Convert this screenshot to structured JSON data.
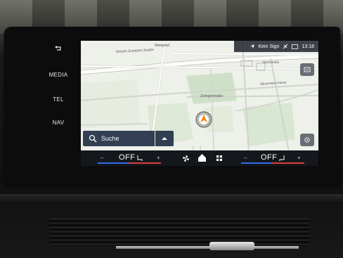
{
  "side_menu": {
    "back_icon": "back-arrow-icon",
    "items": [
      {
        "label": "MEDIA"
      },
      {
        "label": "TEL"
      },
      {
        "label": "NAV"
      }
    ]
  },
  "status_bar": {
    "location_icon": "navigation-arrow-icon",
    "signal_label": "Kein Sign",
    "time": "13:18"
  },
  "map": {
    "streets": [
      "Streets Gumpers Straße",
      "Weinpfad",
      "Alpenstraße",
      "Alfred-Mein-Gasse",
      "Zwingerstraße"
    ]
  },
  "search": {
    "placeholder": "Suche",
    "icon": "search-icon",
    "toggle_icon": "chevron-up-icon"
  },
  "climate": {
    "left": {
      "minus": "–",
      "value": "OFF",
      "plus": "+"
    },
    "right": {
      "minus": "–",
      "value": "OFF",
      "plus": "+"
    },
    "icons": [
      "fan-icon",
      "home-icon",
      "apps-grid-icon"
    ],
    "colors": {
      "cold": "#2f6cf0",
      "hot": "#e23b3b"
    }
  }
}
